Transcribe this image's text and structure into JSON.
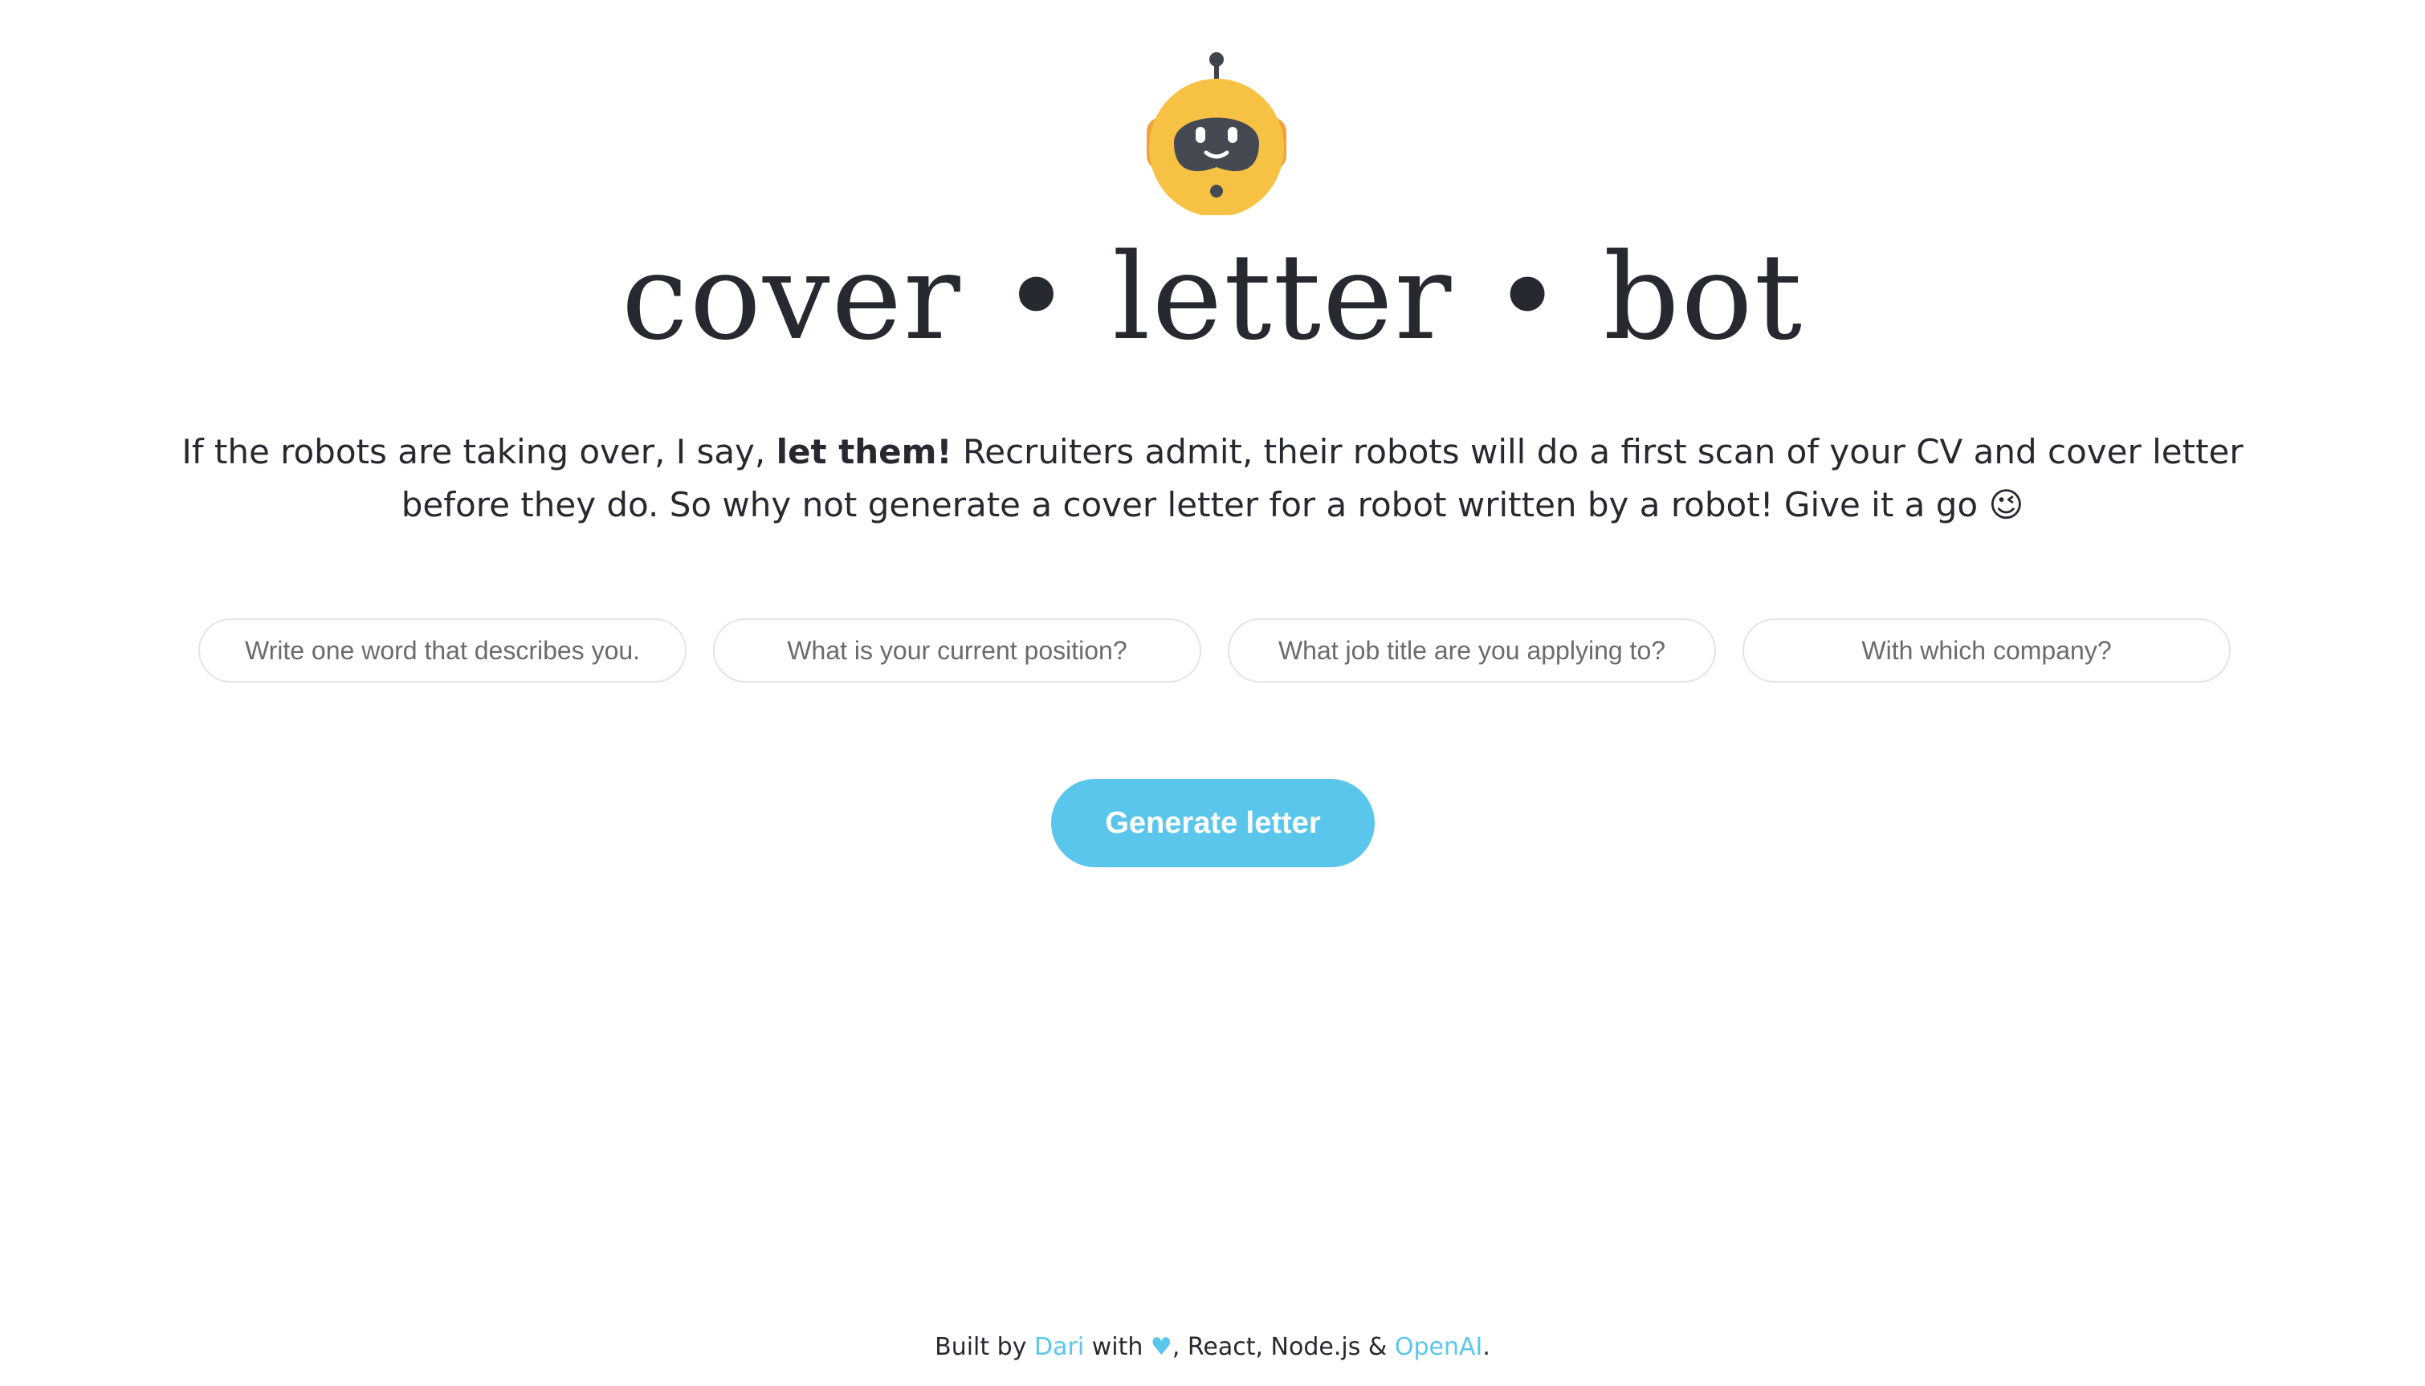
{
  "brand": {
    "logo": "robot-icon",
    "title": "cover • letter • bot"
  },
  "intro": {
    "part1": "If the robots are taking over, I say, ",
    "bold": "let them!",
    "part2": " Recruiters admit, their robots will do a first scan of your CV and cover letter before they do. So why not generate a cover letter for a robot written by a robot! Give it a go ",
    "emoji": "😉"
  },
  "form": {
    "fields": [
      {
        "value": "",
        "placeholder": "Write one word that describes you."
      },
      {
        "value": "",
        "placeholder": "What is your current position?"
      },
      {
        "value": "",
        "placeholder": "What job title are you applying to?"
      },
      {
        "value": "",
        "placeholder": "With which company?"
      }
    ],
    "button_label": "Generate letter"
  },
  "footer": {
    "built_by": "Built by ",
    "author": "Dari",
    "with": " with ",
    "heart": "♥",
    "tech": ", React, Node.js & ",
    "openai": "OpenAI",
    "end": "."
  },
  "colors": {
    "accent": "#5bc6ec",
    "text": "#262a30",
    "robot_yellow": "#f7c244",
    "robot_face": "#454a52"
  }
}
